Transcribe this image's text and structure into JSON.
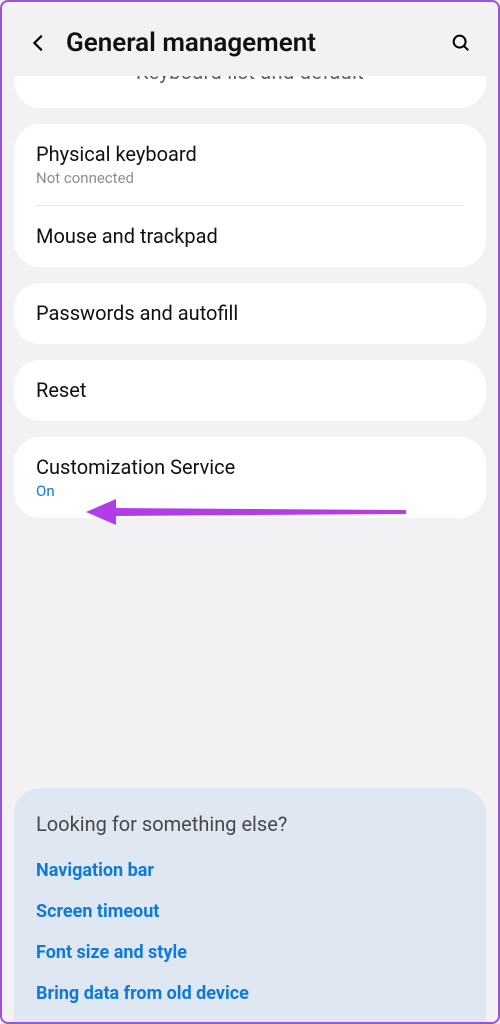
{
  "header": {
    "title": "General management"
  },
  "cut_card": {
    "ghost_label": "Keyboard list and default"
  },
  "group1": {
    "physical_keyboard": {
      "title": "Physical keyboard",
      "sub": "Not connected"
    },
    "mouse_trackpad": {
      "title": "Mouse and trackpad"
    }
  },
  "group2": {
    "passwords_autofill": {
      "title": "Passwords and autofill"
    }
  },
  "group3": {
    "reset": {
      "title": "Reset"
    }
  },
  "group4": {
    "customization": {
      "title": "Customization Service",
      "sub": "On"
    }
  },
  "suggest": {
    "title": "Looking for something else?",
    "links": {
      "nav_bar": "Navigation bar",
      "screen_timeout": "Screen timeout",
      "font_size": "Font size and style",
      "bring_data": "Bring data from old device"
    }
  },
  "annotation": {
    "arrow_color": "#b23ce8"
  }
}
